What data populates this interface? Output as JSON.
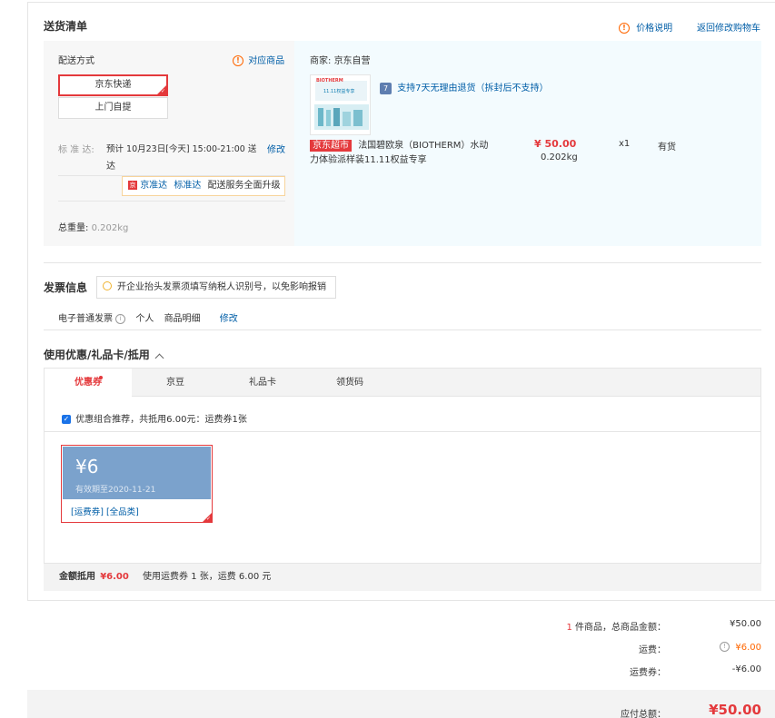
{
  "shipping_list": {
    "title": "送货清单",
    "price_note": "价格说明",
    "back_to_cart": "返回修改购物车"
  },
  "delivery": {
    "method_label": "配送方式",
    "matching_goods": "对应商品",
    "options": [
      "京东快递",
      "上门自提"
    ],
    "standard_label": "标 准 达:",
    "standard_time_line1": "预计 10月23日[今天] 15:00-21:00 送",
    "standard_time_line2": "达",
    "modify": "修改",
    "tip": {
      "badge": "京",
      "link1": "京准达",
      "link2": "标准达",
      "text": "配送服务全面升级"
    },
    "total_weight_label": "总重量:",
    "total_weight_value": "0.202kg"
  },
  "merchant": {
    "label": "商家:",
    "name": "京东自营",
    "return_badge": "7",
    "return_text": "支持7天无理由退货（拆封后不支持）"
  },
  "product": {
    "tag": "京东超市",
    "name_line1": "法国碧欧泉（BIOTHERM）水动",
    "name_line2": "力体验派样装11.11权益专享",
    "price": "¥ 50.00",
    "weight": "0.202kg",
    "qty": "x1",
    "stock": "有货",
    "img_text_brand": "BIOTHERM",
    "img_text_title": "11.11权益专享"
  },
  "invoice": {
    "title": "发票信息",
    "tip": "开企业抬头发票须填写纳税人识别号，以免影响报销",
    "type": "电子普通发票",
    "info_icon": "i",
    "head": "个人",
    "content": "商品明细",
    "modify": "修改"
  },
  "coupon_section": {
    "title": "使用优惠/礼品卡/抵用",
    "tabs": [
      "优惠券",
      "京豆",
      "礼品卡",
      "领货码"
    ],
    "recommend": "优惠组合推荐，共抵用6.00元：运费券1张",
    "coupon": {
      "amount": "¥6",
      "expiry": "有效期至2020-11-21",
      "tag1": "[运费券]",
      "tag2": "[全品类]"
    },
    "footer_label": "金额抵用",
    "footer_amount": "¥6.00",
    "footer_text": "使用运费券 1 张，运费 6.00 元"
  },
  "summary": {
    "count": "1",
    "goods_label": "件商品，总商品金额：",
    "goods_value": "¥50.00",
    "freight_label": "运费：",
    "freight_value": "¥6.00",
    "freight_coupon_label": "运费券：",
    "freight_coupon_value": "-¥6.00",
    "payable_label": "应付总额：",
    "payable_value": "¥50.00"
  },
  "colors": {
    "accent_red": "#e4393c",
    "link_blue": "#005ea7",
    "warn_orange": "#ff6600"
  }
}
